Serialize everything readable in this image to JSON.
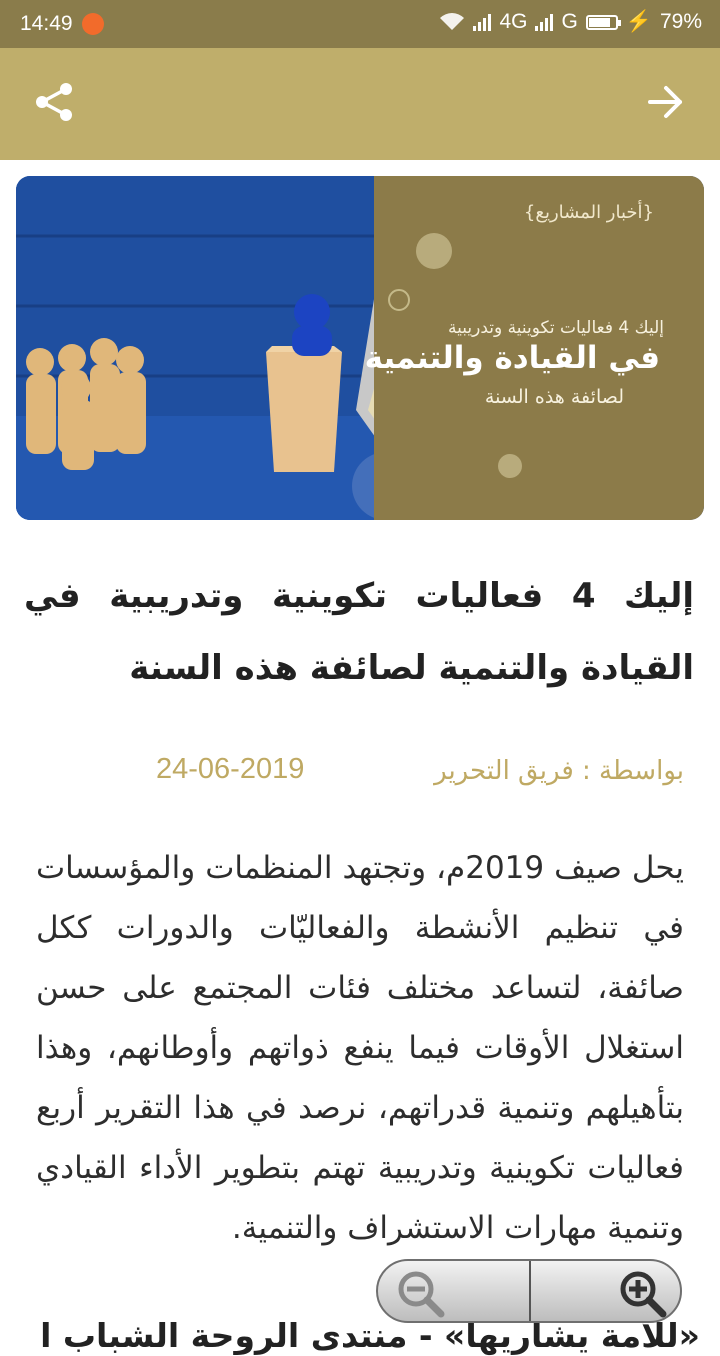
{
  "status_bar": {
    "time": "14:49",
    "network": "4G",
    "network2": "G",
    "battery": "79%"
  },
  "app_bar": {
    "share_icon": "share-icon",
    "back_icon": "arrow-right-icon",
    "color": "#bfae6b"
  },
  "banner": {
    "tag": "{أخبار المشاريع}",
    "headline_small": "إليك 4 فعاليات تكوينية وتدريبية",
    "headline_big": "في القيادة والتنمية",
    "headline_sub": "لصائفة هذه السنة"
  },
  "article": {
    "title": "إليك 4 فعاليات تكوينية وتدريبية في القيادة والتنمية لصائفة هذه السنة",
    "author": "بواسطة : فريق التحرير",
    "date": "24-06-2019",
    "body": "يحل صيف 2019م، وتجتهد المنظمات والمؤسسات في تنظيم الأنشطة والفعاليّات والدورات ككل صائفة، لتساعد مختلف فئات المجتمع على حسن استغلال الأوقات فيما ينفع ذواتهم وأوطانهم، وهذا بتأهيلهم وتنمية قدراتهم، نرصد في هذا التقرير أربع فعاليات تكوينية وتدريبية تهتم بتطوير الأداء القيادي وتنمية مهارات الاستشراف والتنمية.",
    "next_line": "«للأمة يشاريها» - منتدى الروحة الشباب الإسلام"
  },
  "zoom": {
    "zoom_out_icon": "zoom-out-icon",
    "zoom_in_icon": "zoom-in-icon"
  }
}
